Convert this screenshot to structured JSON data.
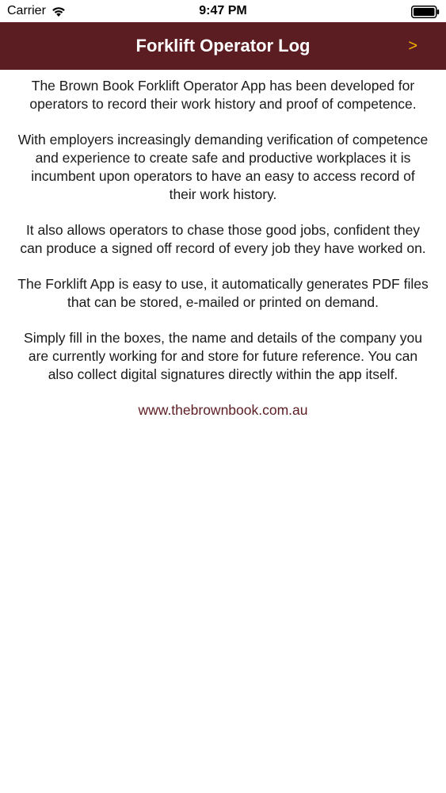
{
  "status_bar": {
    "carrier": "Carrier",
    "time": "9:47 PM",
    "wifi_icon": "wifi-icon",
    "battery_icon": "battery-icon"
  },
  "nav": {
    "title": "Forklift Operator Log",
    "next_label": ">",
    "background_color": "#5b1d22",
    "accent_color": "#f5b400"
  },
  "content": {
    "paragraphs": [
      "The Brown Book Forklift Operator App has been developed for operators to record their work history and proof of competence.",
      "With employers increasingly demanding verification of competence and experience to create safe and productive workplaces it is incumbent upon operators to have an easy to access record of their work history.",
      "It also allows operators to chase those good jobs, confident they can produce a signed off record of every job they have worked on.",
      "The Forklift App is easy to use, it automatically generates PDF files that can be stored, e-mailed or printed on demand.",
      "Simply fill in the boxes, the name and details of the company you are currently working for and store for future reference.  You can also collect digital signatures directly within the app itself."
    ],
    "link_text": "www.thebrownbook.com.au"
  }
}
